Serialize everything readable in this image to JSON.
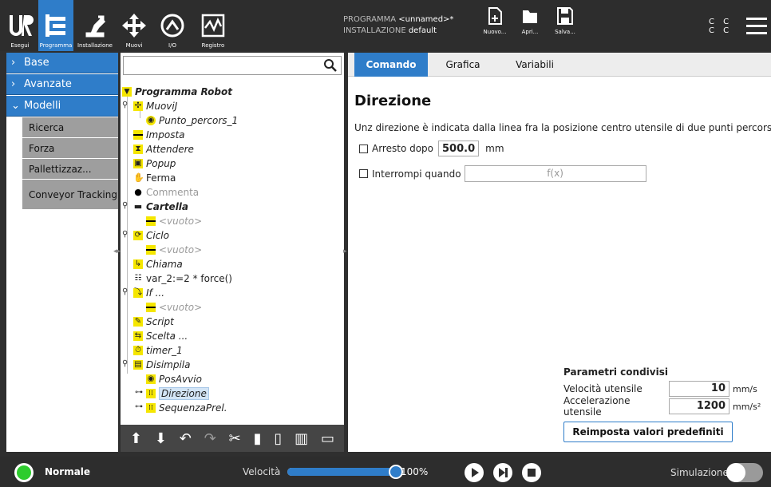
{
  "topbar": {
    "nav": [
      {
        "label": "Esegui",
        "icon": "ur-logo-icon"
      },
      {
        "label": "Programma",
        "icon": "program-tree-icon",
        "active": true
      },
      {
        "label": "Installazione",
        "icon": "robot-arm-icon"
      },
      {
        "label": "Muovi",
        "icon": "move-arrows-icon"
      },
      {
        "label": "I/O",
        "icon": "io-icon"
      },
      {
        "label": "Registro",
        "icon": "log-chart-icon"
      }
    ],
    "programma_label": "PROGRAMMA",
    "programma_value": "<unnamed>*",
    "installazione_label": "INSTALLAZIONE",
    "installazione_value": "default",
    "file_buttons": [
      {
        "label": "Nuovo...",
        "icon": "new-file-icon"
      },
      {
        "label": "Apri...",
        "icon": "folder-icon"
      },
      {
        "label": "Salva...",
        "icon": "save-icon"
      }
    ],
    "cc_top": "C C",
    "cc_bottom": "C C"
  },
  "leftnav": {
    "base": "Base",
    "avanzate": "Avanzate",
    "modelli": "Modelli",
    "sub": [
      "Ricerca",
      "Forza",
      "Pallettizzaz...",
      "Conveyor Tracking"
    ]
  },
  "tree": {
    "search_placeholder": "",
    "root": "Programma Robot",
    "items": [
      "MuoviJ",
      "Punto_percors_1",
      "Imposta",
      "Attendere",
      "Popup",
      "Ferma",
      "Commenta",
      "Cartella",
      "<vuoto>",
      "Ciclo",
      "<vuoto>",
      "Chiama",
      "var_2:=2 * force()",
      "If ...",
      "<vuoto>",
      "Script",
      "Scelta ...",
      "timer_1",
      "Disimpila",
      "PosAvvio",
      "Direzione",
      "SequenzaPrel."
    ]
  },
  "right": {
    "tabs": [
      "Comando",
      "Grafica",
      "Variabili"
    ],
    "title": "Direzione",
    "description": "Unz direzione è indicata dalla linea fra la posizione centro utensile di due punti percorso.",
    "arresto_label": "Arresto dopo",
    "arresto_value": "500.0",
    "arresto_unit": "mm",
    "interrompi_label": "Interrompi quando",
    "fx_placeholder": "f(x)",
    "shared_header": "Parametri condivisi",
    "velocita_label": "Velocità utensile",
    "velocita_value": "10",
    "velocita_unit": "mm/s",
    "accel_label": "Accelerazione utensile",
    "accel_value": "1200",
    "accel_unit": "mm/s²",
    "reset_button": "Reimposta valori predefiniti"
  },
  "bottombar": {
    "mode": "Normale",
    "speed_label": "Velocità",
    "speed_fraction": 1.0,
    "speed_pct": "100%",
    "sim_label": "Simulazione"
  },
  "colors": {
    "accent": "#2f7dc9",
    "topbar": "#2d2d2d",
    "status_green": "#2ecc2e"
  }
}
